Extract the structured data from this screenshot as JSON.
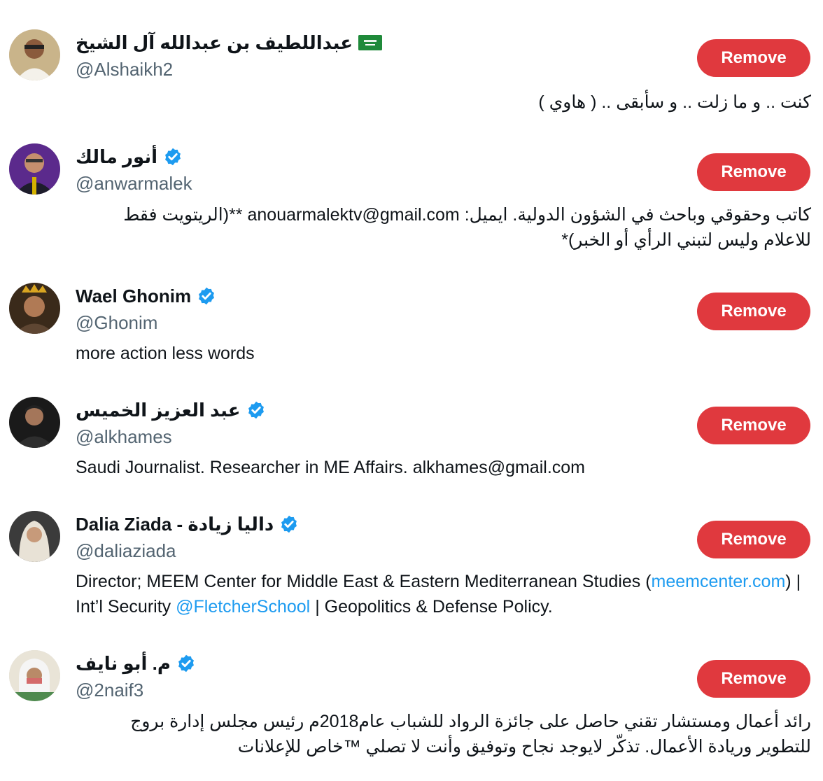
{
  "remove_label": "Remove",
  "colors": {
    "remove_bg": "#e0393e",
    "verified": "#1d9bf0",
    "link": "#1d9bf0"
  },
  "users": [
    {
      "display_name": "عبداللطيف بن عبدالله آل الشيخ",
      "handle": "@Alshaikh2",
      "badge": "saudi-flag",
      "bio": "كنت .. و ما زلت .. و سأبقى .. ( هاوي )"
    },
    {
      "display_name": "أنور مالك",
      "handle": "@anwarmalek",
      "badge": "verified",
      "bio": "كاتب وحقوقي وباحث في الشؤون الدولية. ايميل: anouarmalektv@gmail.com **(الريتويت فقط للاعلام وليس لتبني الرأي أو الخبر)*"
    },
    {
      "display_name": "Wael Ghonim",
      "handle": "@Ghonim",
      "badge": "verified",
      "bio": "more action less words"
    },
    {
      "display_name": "عبد العزيز الخميس",
      "handle": "@alkhames",
      "badge": "verified",
      "bio": "Saudi Journalist. Researcher in ME Affairs. alkhames@gmail.com"
    },
    {
      "display_name": "Dalia Ziada - داليا زيادة",
      "handle": "@daliaziada",
      "badge": "verified",
      "bio_part1": "Director; MEEM Center for Middle East & Eastern Mediterranean Studies (",
      "bio_link1": "meemcenter.com",
      "bio_part2": ") | Int’l Security ",
      "bio_link2": "@FletcherSchool",
      "bio_part3": " | Geopolitics & Defense Policy."
    },
    {
      "display_name": "م. أبو نايف",
      "handle": "@2naif3",
      "badge": "verified",
      "bio": "رائد أعمال ومستشار تقني حاصل على جائزة الرواد للشباب عام2018م رئيس مجلس إدارة بروج للتطوير وريادة الأعمال. تذكّر لايوجد نجاح وتوفيق وأنت لا تصلي ™خاص للإعلانات"
    }
  ]
}
